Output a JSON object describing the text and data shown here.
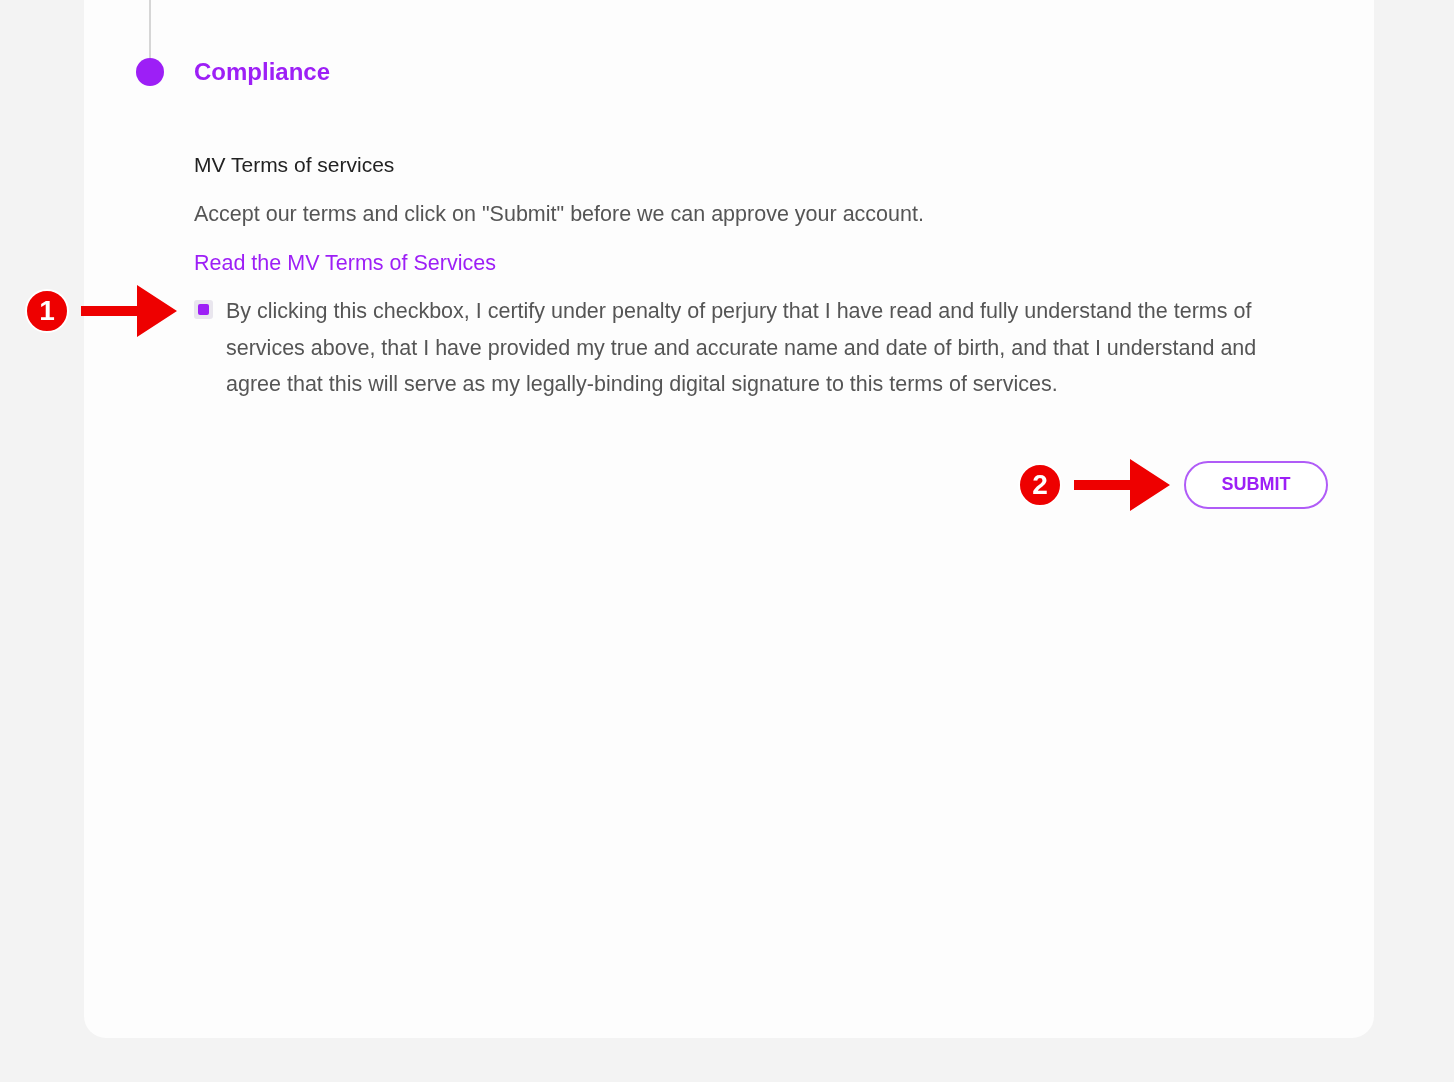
{
  "step": {
    "title": "Compliance",
    "active": true
  },
  "terms": {
    "heading": "MV Terms of services",
    "description": "Accept our terms and click on \"Submit\" before we can approve your account.",
    "link": "Read the MV Terms of Services",
    "checkbox": {
      "checked": true,
      "label": "By clicking this checkbox, I certify under penalty of perjury that I have read and fully understand the terms of services above, that I have provided my true and accurate name and date of birth, and that I understand and agree that this will serve as my legally-binding digital signature to this terms of services."
    }
  },
  "submit_button": "SUBMIT",
  "annotations": [
    {
      "number": "1"
    },
    {
      "number": "2"
    }
  ]
}
